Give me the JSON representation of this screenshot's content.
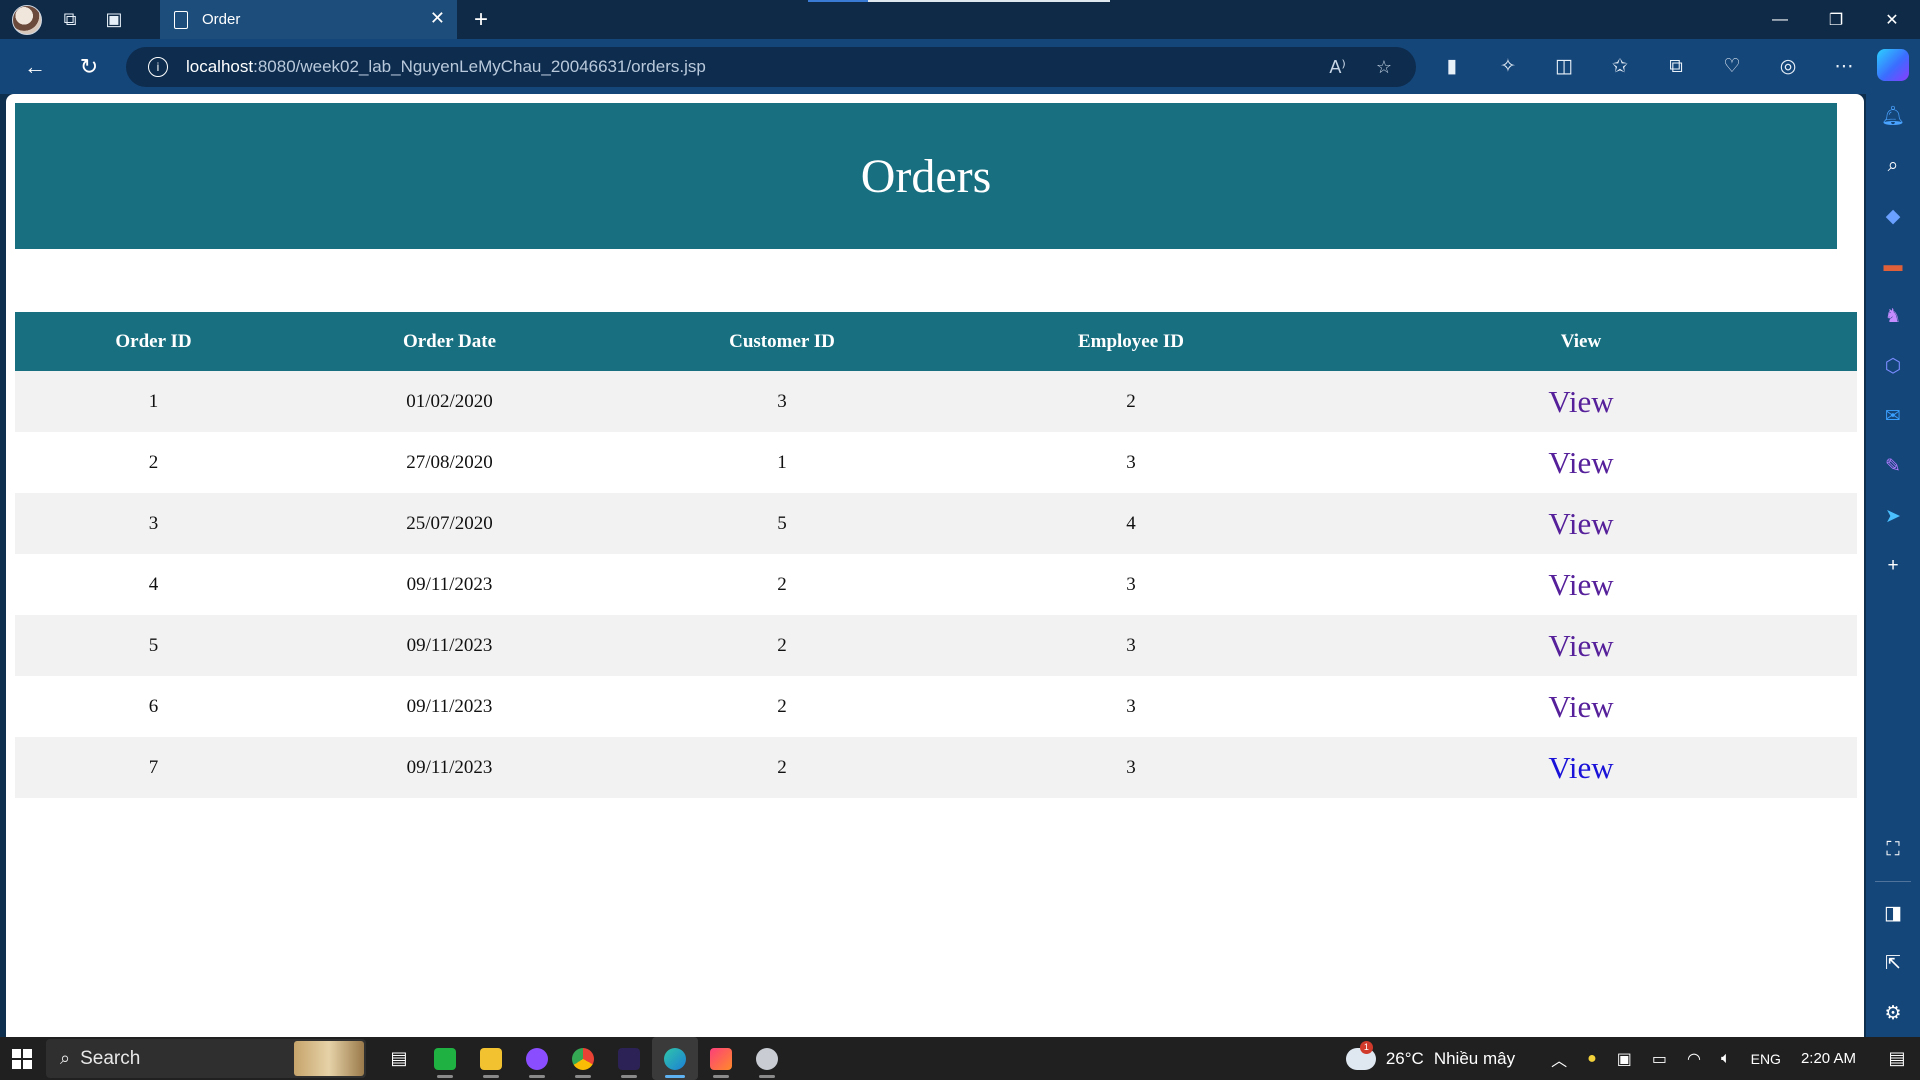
{
  "browser": {
    "tab_title": "Order",
    "tab_close": "✕",
    "new_tab": "+",
    "url_host": "localhost",
    "url_rest": ":8080/week02_lab_NguyenLeMyChau_20046631/orders.jsp",
    "read_aloud": "A⁾",
    "info": "i",
    "window_controls": {
      "minimize": "—",
      "restore": "❐",
      "close": "✕"
    }
  },
  "page": {
    "title": "Orders",
    "table": {
      "columns": [
        "Order ID",
        "Order Date",
        "Customer ID",
        "Employee ID",
        "View"
      ],
      "rows": [
        {
          "order_id": "1",
          "order_date": "01/02/2020",
          "customer_id": "3",
          "employee_id": "2",
          "view": "View"
        },
        {
          "order_id": "2",
          "order_date": "27/08/2020",
          "customer_id": "1",
          "employee_id": "3",
          "view": "View"
        },
        {
          "order_id": "3",
          "order_date": "25/07/2020",
          "customer_id": "5",
          "employee_id": "4",
          "view": "View"
        },
        {
          "order_id": "4",
          "order_date": "09/11/2023",
          "customer_id": "2",
          "employee_id": "3",
          "view": "View"
        },
        {
          "order_id": "5",
          "order_date": "09/11/2023",
          "customer_id": "2",
          "employee_id": "3",
          "view": "View"
        },
        {
          "order_id": "6",
          "order_date": "09/11/2023",
          "customer_id": "2",
          "employee_id": "3",
          "view": "View"
        },
        {
          "order_id": "7",
          "order_date": "09/11/2023",
          "customer_id": "2",
          "employee_id": "3",
          "view": "View"
        }
      ]
    },
    "colors": {
      "header_bg": "#176f80",
      "stripe": "#f2f2f2",
      "visited_link": "#55209a",
      "link": "#1a12d8"
    }
  },
  "taskbar": {
    "search_label": "Search",
    "weather_temp": "26°C",
    "weather_desc": "Nhiều mây",
    "weather_badge": "1",
    "language": "ENG",
    "time": "2:20 AM"
  }
}
